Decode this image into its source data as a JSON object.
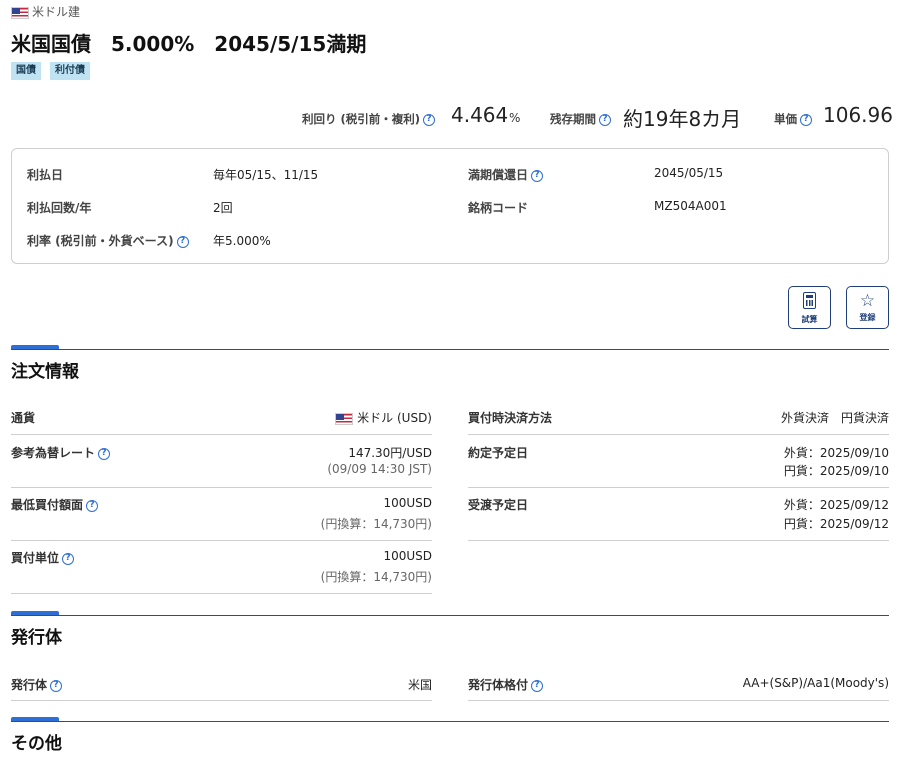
{
  "header": {
    "currency_type": "米ドル建",
    "title": "米国国債　5.000%　2045/5/15満期",
    "tags": [
      "国債",
      "利付債"
    ]
  },
  "metrics": {
    "yield_label": "利回り (税引前・複利)",
    "yield_value": "4.464",
    "yield_unit": "%",
    "remaining_label": "残存期間",
    "remaining_value": "約19年8カ月",
    "price_label": "単価",
    "price_value": "106.96"
  },
  "info": {
    "payment_date_label": "利払日",
    "payment_date_value": "毎年05/15、11/15",
    "payment_count_label": "利払回数/年",
    "payment_count_value": "2回",
    "coupon_label": "利率 (税引前・外貨ベース)",
    "coupon_value": "年5.000%",
    "maturity_label": "満期償還日",
    "maturity_value": "2045/05/15",
    "code_label": "銘柄コード",
    "code_value": "MZ504A001"
  },
  "actions": {
    "simulate_label": "試算",
    "register_label": "登録"
  },
  "order": {
    "title": "注文情報",
    "currency_label": "通貨",
    "currency_value": "米ドル (USD)",
    "rate_label": "参考為替レート",
    "rate_value": "147.30円/USD",
    "rate_sub": "(09/09 14:30 JST)",
    "min_amount_label": "最低買付額面",
    "min_amount_value": "100USD",
    "min_amount_sub": "(円換算：14,730円)",
    "unit_label": "買付単位",
    "unit_value": "100USD",
    "unit_sub": "(円換算：14,730円)",
    "settlement_label": "買付時決済方法",
    "settlement_value": "外貨決済　円貨決済",
    "contract_label": "約定予定日",
    "contract_fx": "外貨：2025/09/10",
    "contract_jpy": "円貨：2025/09/10",
    "delivery_label": "受渡予定日",
    "delivery_fx": "外貨：2025/09/12",
    "delivery_jpy": "円貨：2025/09/12"
  },
  "issuer": {
    "title": "発行体",
    "issuer_label": "発行体",
    "issuer_value": "米国",
    "rating_label": "発行体格付",
    "rating_value": "AA+(S&P)/Aa1(Moody's)"
  },
  "other": {
    "title": "その他"
  },
  "icons": {
    "flag": "us-flag-icon",
    "help": "help-circle-icon",
    "calculator": "calculator-icon",
    "star": "star-plus-icon"
  },
  "colors": {
    "accent": "#2d6fd6",
    "navy": "#1f3f7a",
    "tag_bg": "#bfe3f3"
  }
}
